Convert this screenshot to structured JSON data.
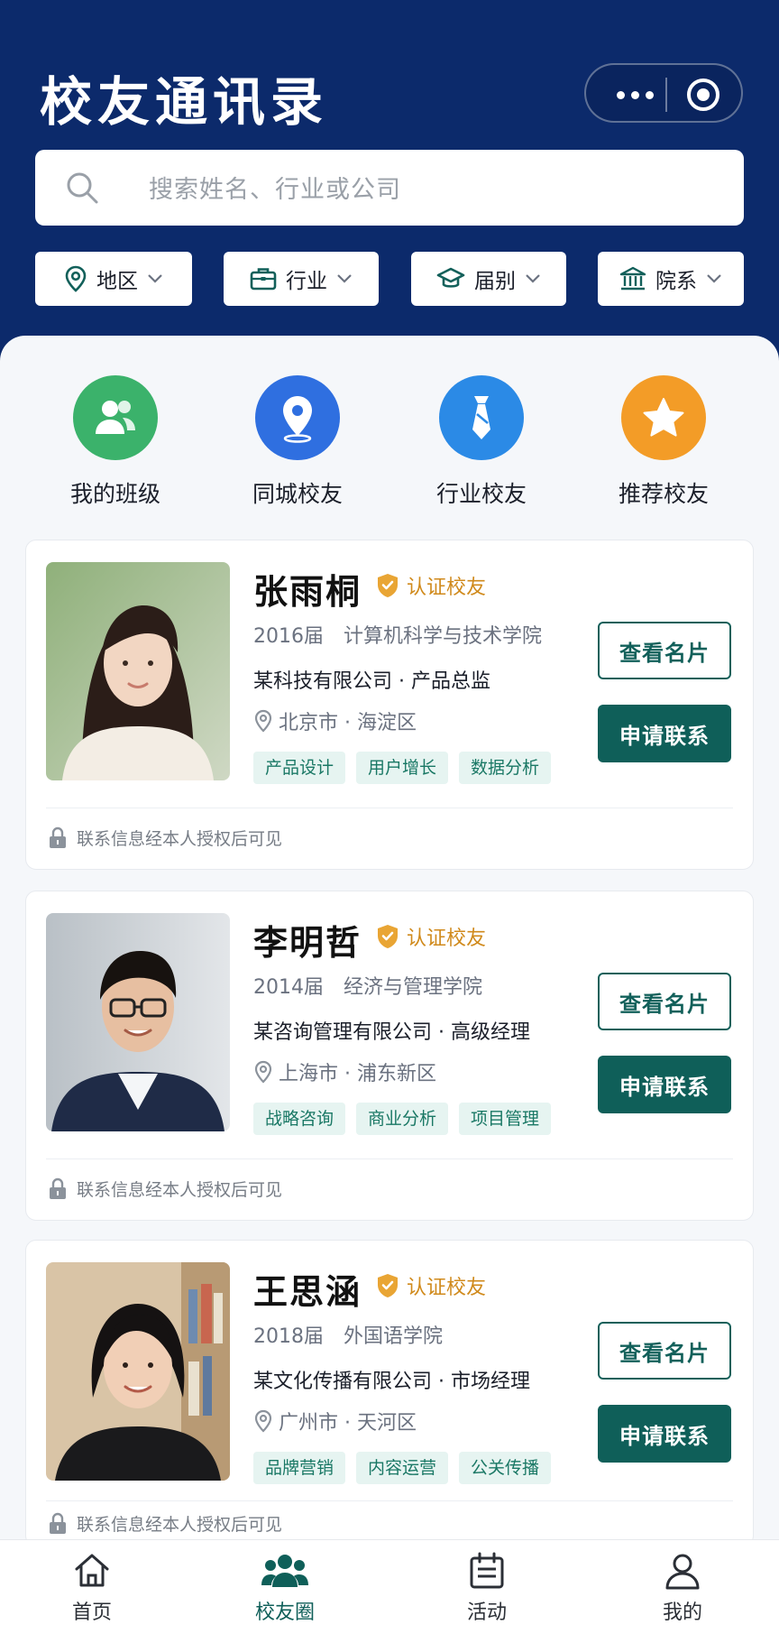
{
  "header": {
    "title": "校友通讯录",
    "search_placeholder": "搜索姓名、行业或公司",
    "filters": [
      {
        "label": "地区",
        "icon": "location-pin-icon"
      },
      {
        "label": "行业",
        "icon": "briefcase-icon"
      },
      {
        "label": "届别",
        "icon": "graduation-cap-icon"
      },
      {
        "label": "院系",
        "icon": "institution-icon"
      }
    ]
  },
  "quick_actions": [
    {
      "label": "我的班级",
      "icon": "people-icon",
      "color": "#3bb26b"
    },
    {
      "label": "同城校友",
      "icon": "location-pin-icon",
      "color": "#2f6fe0"
    },
    {
      "label": "行业校友",
      "icon": "tie-icon",
      "color": "#2b8ae6"
    },
    {
      "label": "推荐校友",
      "icon": "star-icon",
      "color": "#f39c27"
    }
  ],
  "badge_label": "认证校友",
  "privacy_note": "联系信息经本人授权后可见",
  "actions": {
    "view_card": "查看名片",
    "request_contact": "申请联系"
  },
  "alumni": [
    {
      "name": "张雨桐",
      "year": "2016届",
      "college": "计算机科学与技术学院",
      "company": "某科技有限公司 · 产品总监",
      "location": "北京市 · 海淀区",
      "tags": [
        "产品设计",
        "用户增长",
        "数据分析"
      ]
    },
    {
      "name": "李明哲",
      "year": "2014届",
      "college": "经济与管理学院",
      "company": "某咨询管理有限公司 · 高级经理",
      "location": "上海市 · 浦东新区",
      "tags": [
        "战略咨询",
        "商业分析",
        "项目管理"
      ]
    },
    {
      "name": "王思涵",
      "year": "2018届",
      "college": "外国语学院",
      "company": "某文化传播有限公司 · 市场经理",
      "location": "广州市 · 天河区",
      "tags": [
        "品牌营销",
        "内容运营",
        "公关传播"
      ]
    }
  ],
  "tabbar": [
    {
      "label": "首页",
      "icon": "home-icon"
    },
    {
      "label": "校友圈",
      "icon": "alumni-group-icon",
      "active": true
    },
    {
      "label": "活动",
      "icon": "calendar-icon"
    },
    {
      "label": "我的",
      "icon": "user-icon"
    }
  ],
  "colors": {
    "primary_navy": "#0c2a6b",
    "accent_green": "#0f5f59",
    "badge_gold": "#d08a1c"
  }
}
